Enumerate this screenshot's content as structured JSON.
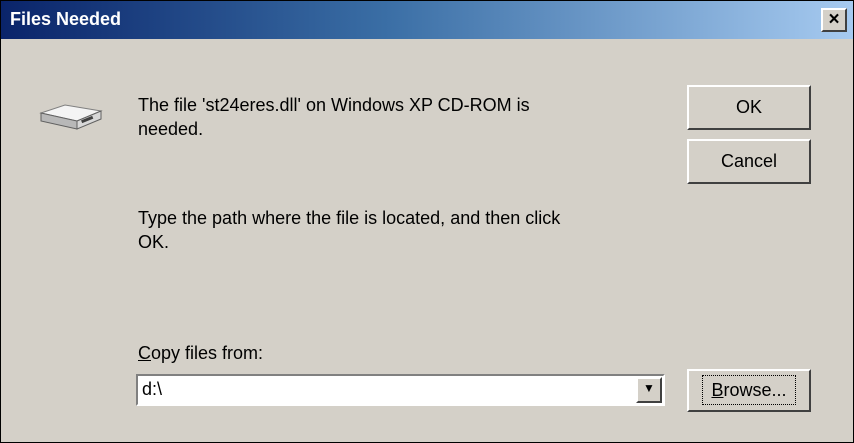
{
  "window": {
    "title": "Files Needed",
    "close_glyph": "×"
  },
  "message": {
    "line1": "The file 'st24eres.dll' on Windows XP CD-ROM is",
    "line2": "needed."
  },
  "instruction": {
    "line1": "Type the path where the file is located, and then click",
    "line2": "OK."
  },
  "copy_from": {
    "label_accel": "C",
    "label_rest": "opy files from:",
    "value": "d:\\",
    "arrow_glyph": "▼"
  },
  "buttons": {
    "ok": "OK",
    "cancel": "Cancel",
    "browse_accel": "B",
    "browse_rest": "rowse..."
  },
  "icons": {
    "drive": "disk-drive-icon"
  }
}
